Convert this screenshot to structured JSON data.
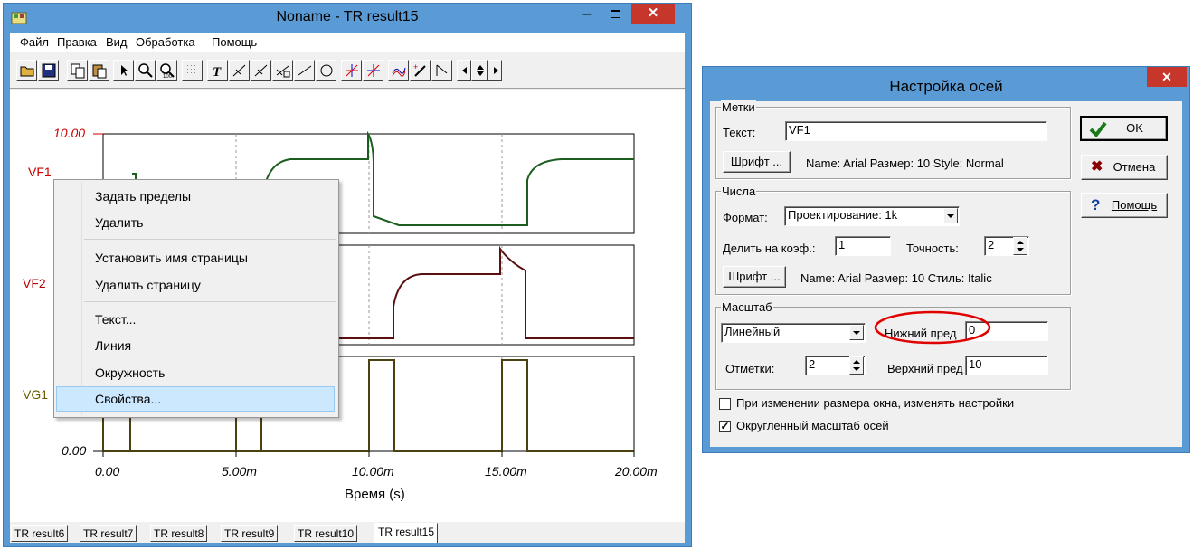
{
  "main_window": {
    "title": "Noname - TR result15",
    "menu": [
      "Файл",
      "Правка",
      "Вид",
      "Обработка",
      "Помощь"
    ],
    "toolbar_icons": [
      "open-icon",
      "save-icon",
      "copy-icon",
      "paste-icon",
      "pointer-icon",
      "zoom-in-icon",
      "zoom-100-icon",
      "grid-icon",
      "text-tool-icon",
      "cursor-a-icon",
      "cursor-b-icon",
      "fourier-icon",
      "line-tool-icon",
      "circle-tool-icon",
      "cursor-x-icon",
      "cursor-y-icon",
      "curves-icon",
      "probe-icon",
      "slope-icon",
      "scroll-left-icon",
      "scroll-up-down-icon",
      "scroll-right-icon"
    ],
    "traces": [
      {
        "name": "VF1",
        "color": "#cc0000"
      },
      {
        "name": "VF2",
        "color": "#b80000"
      },
      {
        "name": "VG1",
        "color": "#6b5a00"
      }
    ],
    "y_top_label": "10.00",
    "y_bottom_label": "0.00",
    "x_ticks": [
      "0.00",
      "5.00m",
      "10.00m",
      "15.00m",
      "20.00m"
    ],
    "x_label": "Время (s)",
    "tabs": [
      "TR result6",
      "TR result7",
      "TR result8",
      "TR result9",
      "TR result10",
      "TR result15"
    ],
    "active_tab": "TR result15"
  },
  "context_menu": {
    "items": [
      "Задать пределы",
      "Удалить",
      "Установить имя страницы",
      "Удалить страницу",
      "Текст...",
      "Линия",
      "Окружность",
      "Свойства..."
    ],
    "selected": "Свойства..."
  },
  "dialog": {
    "title": "Настройка осей",
    "labels_group": {
      "title": "Метки",
      "text_label": "Текст:",
      "text_value": "VF1",
      "font_button": "Шрифт ...",
      "font_info": "Name: Arial Размер: 10 Style: Normal"
    },
    "numbers_group": {
      "title": "Числа",
      "format_label": "Формат:",
      "format_value": "Проектирование: 1k",
      "divide_label": "Делить на коэф.:",
      "divide_value": "1",
      "precision_label": "Точность:",
      "precision_value": "2",
      "font_button": "Шрифт ...",
      "font_info": "Name: Arial Размер: 10 Стиль: Italic"
    },
    "scale_group": {
      "title": "Масштаб",
      "scale_value": "Линейный",
      "lower_label": "Нижний пред",
      "lower_value": "0",
      "ticks_label": "Отметки:",
      "ticks_value": "2",
      "upper_label": "Верхний пред",
      "upper_value": "10"
    },
    "resize_checkbox": {
      "label": "При изменении размера окна, изменять настройки",
      "checked": false
    },
    "round_checkbox": {
      "label": "Округленный масштаб осей",
      "checked": true
    },
    "buttons": {
      "ok": "OK",
      "cancel": "Отмена",
      "help": "Помощь"
    },
    "highlight_color": "#e00000"
  }
}
